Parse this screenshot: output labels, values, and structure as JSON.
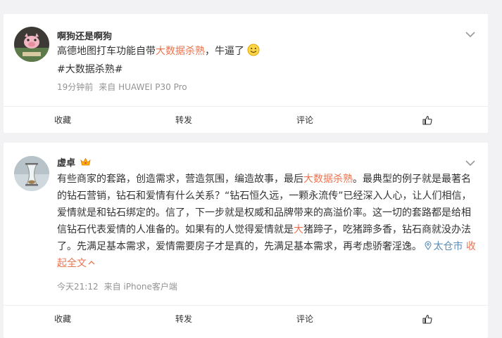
{
  "post1": {
    "username": "啊狗还是啊狗",
    "text_prefix": "高德地图打车功能自带",
    "text_highlight": "大数据杀熟",
    "text_suffix": "，牛逼了",
    "topic": "#大数据杀熟#",
    "time": "19分钟前",
    "source": "来自 HUAWEI P30 Pro",
    "actions": {
      "favorite": "收藏",
      "repost": "转发",
      "comment": "评论"
    }
  },
  "post2": {
    "username": "虚卓",
    "text_a": "有些商家的套路，创造需求，营造氛围，编造故事，最后",
    "text_highlight1": "大数据杀熟",
    "text_b": "。最典型的例子就是最著名的钻石营销，钻石和爱情有什么关系？“钻石恒久远，一颗永流传”已经深入人心，让人们相信，爱情就是和钻石绑定的。信了，下一步就是权威和品牌带来的高溢价率。这一切的套路都是给相信钻石代表爱情的人准备的。如果有的人觉得爱情就是",
    "text_highlight2": "大",
    "text_c": "猪蹄子，吃猪蹄多香，钻石商就没办法了。先满足基本需求，爱情需要房子才是真的，先满足基本需求，再考虑骄奢淫逸。",
    "location": "太仓市",
    "collapse": "收起全文",
    "time": "今天21:12",
    "source": "来自 iPhone客户端",
    "actions": {
      "favorite": "收藏",
      "repost": "转发",
      "comment": "评论"
    }
  },
  "colors": {
    "highlight": "#eb7350",
    "link": "#eb7350",
    "location": "#5b8db8",
    "meta": "#939393"
  }
}
